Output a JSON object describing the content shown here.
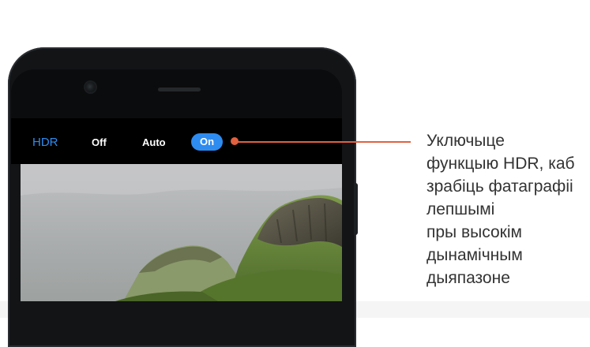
{
  "camera_bar": {
    "title": "HDR",
    "options": [
      "Off",
      "Auto",
      "On"
    ],
    "selected": "On",
    "accent_color": "#2e8cf0"
  },
  "callout": {
    "lines": [
      "Уключыце",
      "функцыю HDR, каб",
      "зрабіць фатаграфіі",
      "лепшымі",
      "пры высокім",
      "дынамічным",
      "дыяпазоне"
    ],
    "line_color": "#e06140"
  },
  "icons": {
    "front_camera": "front-camera-icon",
    "speaker": "earpiece-speaker-icon"
  }
}
